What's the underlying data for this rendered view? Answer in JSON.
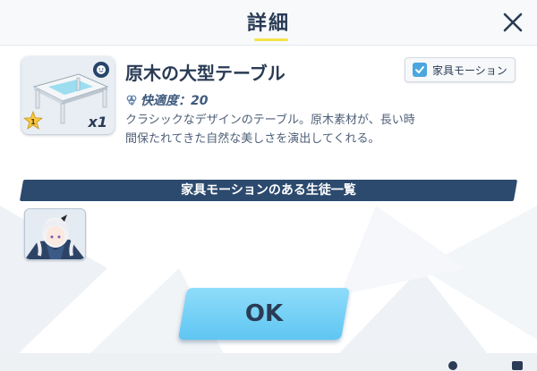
{
  "dialog": {
    "title": "詳細",
    "close_icon": "close-icon"
  },
  "item": {
    "name": "原木の大型テーブル",
    "quantity": "x1",
    "star_level": "1",
    "comfort_label": "快適度：20",
    "description": "クラシックなデザインのテーブル。原木素材が、長い時間保たれてきた自然な美しさを演出してくれる。",
    "motion_toggle_label": "家具モーション",
    "motion_toggle_checked": true
  },
  "student_list": {
    "title": "家具モーションのある生徒一覧"
  },
  "footer": {
    "ok_label": "OK"
  },
  "colors": {
    "accent": "#f4e34a",
    "button": "#6fd0f6",
    "header_bar": "#2c4a6e",
    "text": "#2a3b55"
  }
}
